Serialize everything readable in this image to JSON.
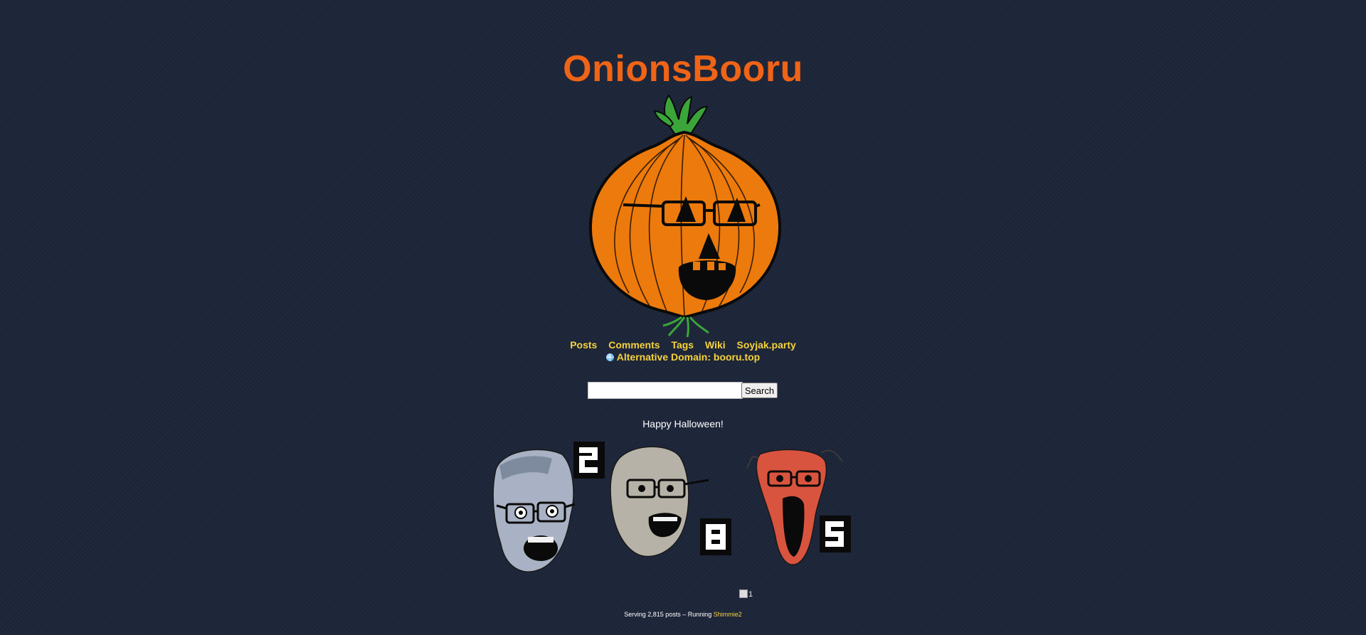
{
  "site": {
    "title": "OnionsBooru",
    "mascot_icon": "onion-jack-o-lantern"
  },
  "nav": {
    "items": [
      {
        "label": "Posts"
      },
      {
        "label": "Comments"
      },
      {
        "label": "Tags"
      },
      {
        "label": "Wiki"
      },
      {
        "label": "Soyjak.party"
      }
    ],
    "alt_domain": "Alternative Domain: booru.top",
    "alt_domain_icon": "globe-icon"
  },
  "search": {
    "value": "",
    "button_label": "Search"
  },
  "message": "Happy Halloween!",
  "counter": {
    "digits": [
      "2",
      "8",
      "1",
      "5"
    ]
  },
  "broken_image_alt": "1",
  "footer": {
    "text": "Serving 2,815 posts – Running ",
    "link": "Shimmie2"
  },
  "colors": {
    "background": "#1c2438",
    "title": "#ef6416",
    "link": "#f5d33b"
  }
}
